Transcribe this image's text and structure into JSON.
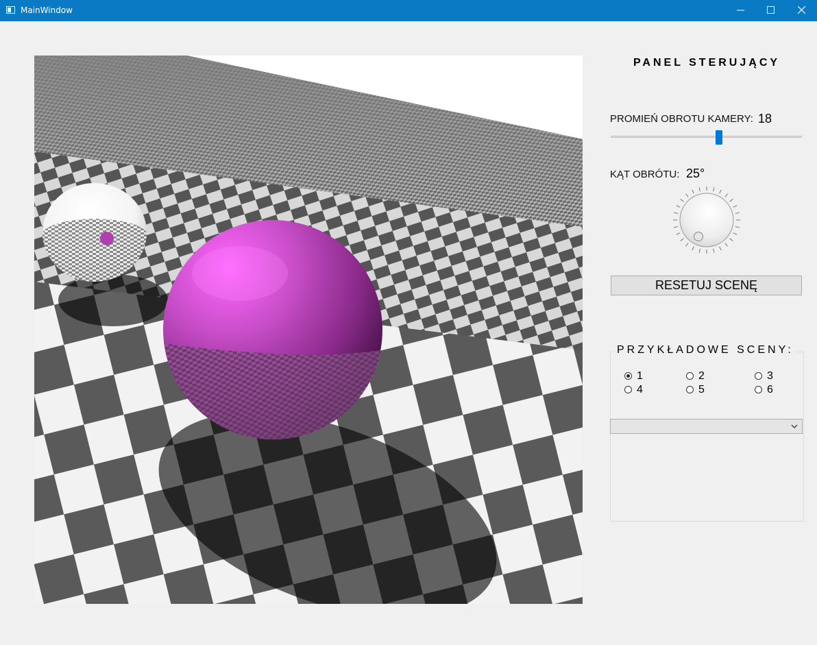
{
  "window": {
    "title": "MainWindow",
    "controls": {
      "minimize": "minimize-icon",
      "maximize": "maximize-icon",
      "close": "close-icon"
    },
    "titlebar_color": "#0a7ac4"
  },
  "render": {
    "description_icon": "raytraced-scene",
    "sphere_colors": {
      "magenta": "#c040c0",
      "mirror": "#ffffff"
    }
  },
  "panel": {
    "title": "PANEL STERUJĄCY",
    "radius_label": "PROMIEŃ OBROTU KAMERY:",
    "radius_value": "18",
    "radius_fraction": 0.57,
    "angle_label": "KĄT OBRÓTU:",
    "angle_value": "25°",
    "reset_label": "RESETUJ SCENĘ",
    "accent": "#0078d7"
  },
  "scenes": {
    "title": "PRZYKŁADOWE SCENY:",
    "options": [
      "1",
      "2",
      "3",
      "4",
      "5",
      "6"
    ],
    "selected": "1",
    "combo_value": ""
  }
}
